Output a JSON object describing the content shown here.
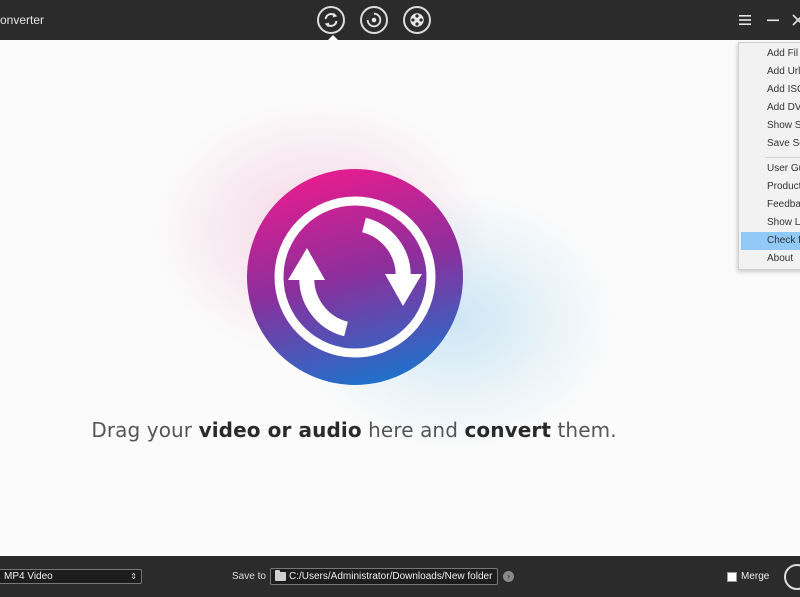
{
  "titlebar": {
    "app_title": "onverter",
    "mode_tabs": [
      {
        "name": "convert",
        "icon": "convert-arrows-icon",
        "active": true
      },
      {
        "name": "burn",
        "icon": "disc-icon",
        "active": false
      },
      {
        "name": "toolbox",
        "icon": "film-reel-icon",
        "active": false
      }
    ],
    "window_buttons": [
      "menu-icon",
      "minimize-icon",
      "close-icon"
    ]
  },
  "main": {
    "drop_hint": {
      "part1": "Drag your ",
      "bold1": "video or audio",
      "part2": " here and ",
      "bold2": "convert",
      "part3": " them."
    },
    "logo_icon": "convert-circle-icon"
  },
  "menu": {
    "items": [
      "Add Fil",
      "Add Url",
      "Add ISO",
      "Add DV",
      "Show Sc",
      "Save Sc",
      "User Gu",
      "Product",
      "Feedbac",
      "Show Lo",
      "Check f",
      "About"
    ],
    "highlighted": "Check f"
  },
  "bottombar": {
    "format_value": "MP4 Video",
    "save_to_label": "Save to",
    "save_path": "C:/Users/Administrator/Downloads/New folder",
    "merge_label": "Merge",
    "merge_checked": false
  },
  "colors": {
    "bar_bg": "#2b2b2b",
    "logo_gradient_top": "#e81c8f",
    "logo_gradient_bottom": "#1e72cc",
    "menu_highlight": "#91c9f7"
  }
}
